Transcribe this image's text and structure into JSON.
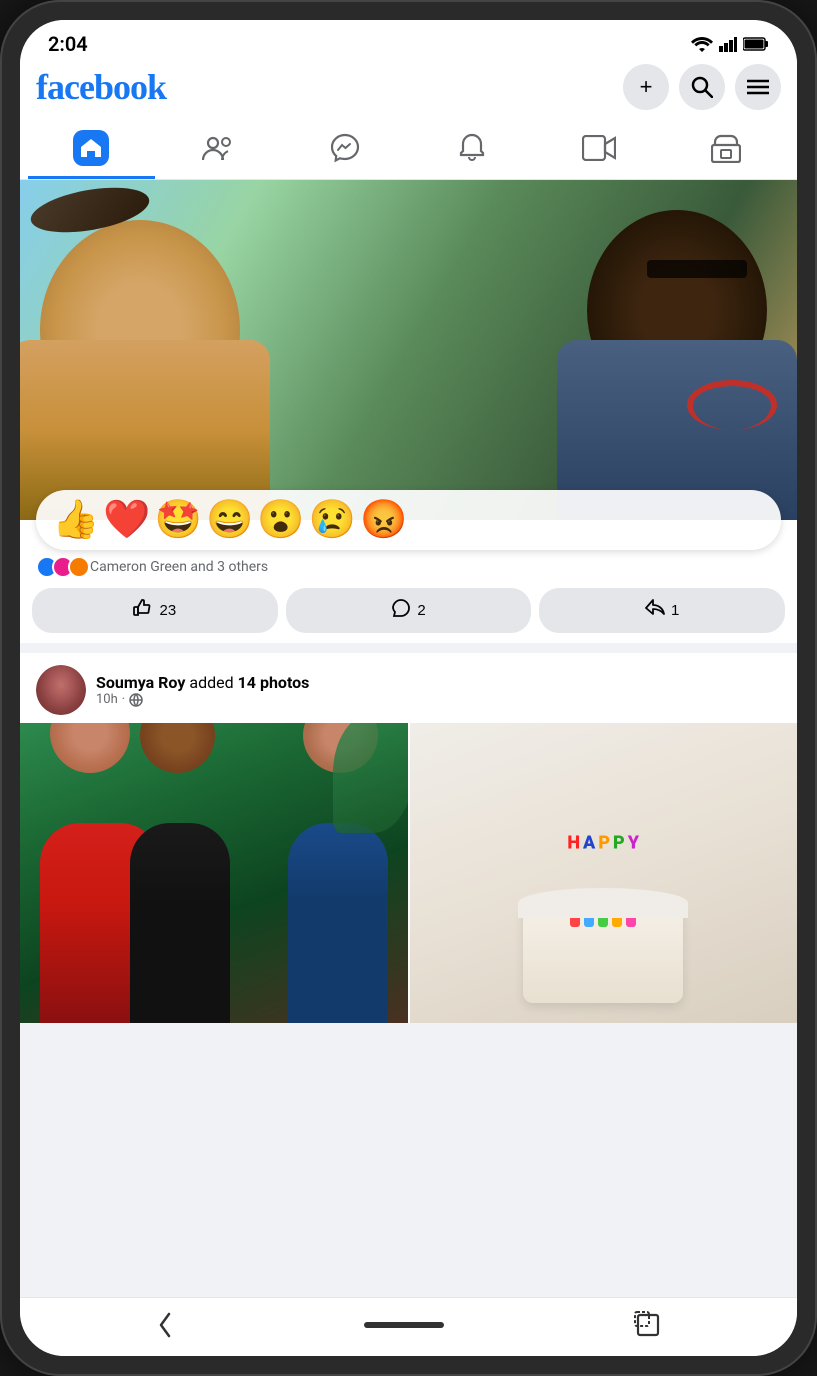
{
  "device": {
    "time": "2:04",
    "battery_level": "full",
    "signal": "full",
    "wifi": "full"
  },
  "app": {
    "name": "facebook",
    "logo": "facebook"
  },
  "header": {
    "add_button": "+",
    "search_button": "🔍",
    "menu_button": "☰"
  },
  "nav": {
    "tabs": [
      {
        "id": "home",
        "label": "Home",
        "active": true
      },
      {
        "id": "friends",
        "label": "Friends",
        "active": false
      },
      {
        "id": "messenger",
        "label": "Messenger",
        "active": false
      },
      {
        "id": "notifications",
        "label": "Notifications",
        "active": false
      },
      {
        "id": "video",
        "label": "Video",
        "active": false
      },
      {
        "id": "marketplace",
        "label": "Marketplace",
        "active": false
      }
    ]
  },
  "feed": {
    "posts": [
      {
        "id": "post1",
        "type": "photo",
        "reactions": {
          "liked_by": "Cameron Green and 3 others",
          "emojis": [
            "👍",
            "❤️",
            "🤩",
            "😄",
            "😮",
            "😢",
            "😡"
          ]
        },
        "actions": {
          "like": {
            "count": "23",
            "label": "23"
          },
          "comment": {
            "count": "2",
            "label": "2"
          },
          "share": {
            "count": "1",
            "label": "1"
          }
        }
      },
      {
        "id": "post2",
        "type": "photos",
        "author": "Soumya Roy",
        "action_text": "added",
        "action_detail": "14 photos",
        "time": "10h",
        "privacy": "public",
        "full_text": "Soumya Roy added 14 photos"
      }
    ]
  },
  "bottom_nav": {
    "back": "‹",
    "home_pill": "",
    "rotate": "⤢"
  }
}
